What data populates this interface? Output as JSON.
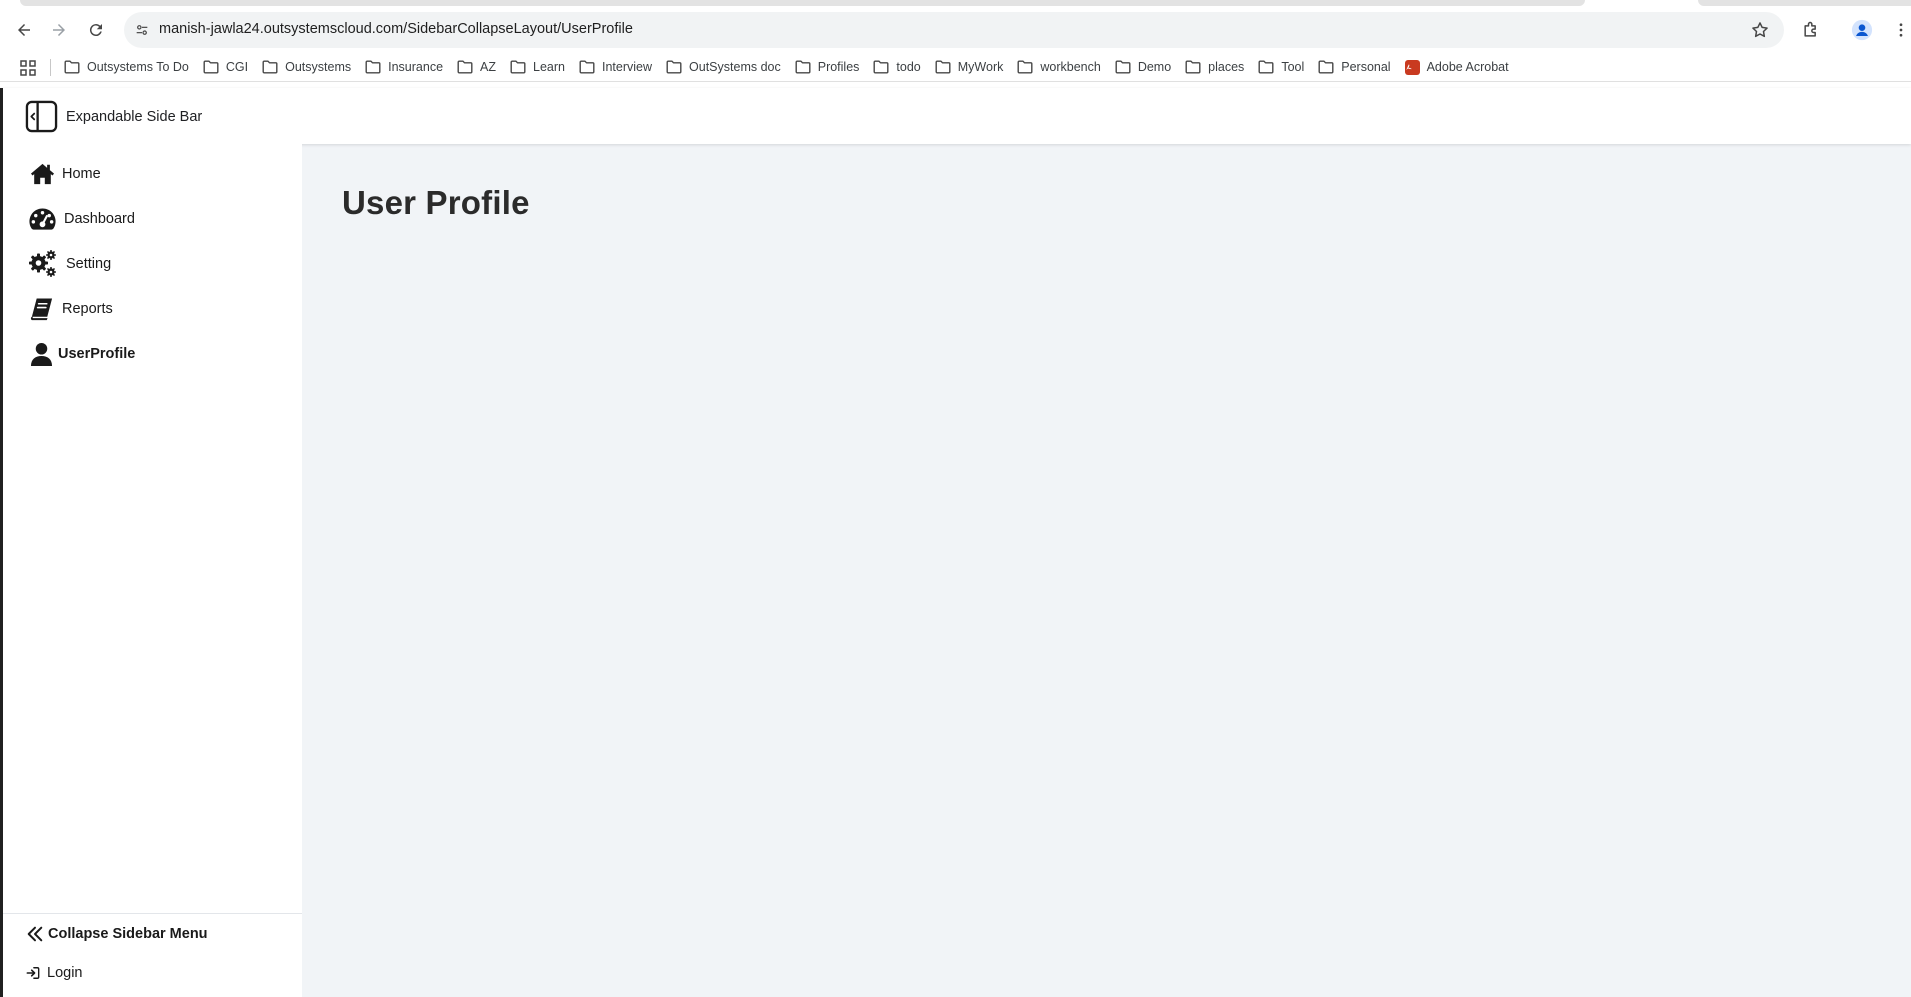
{
  "browser": {
    "url": "manish-jawla24.outsystemscloud.com/SidebarCollapseLayout/UserProfile",
    "bookmarks": [
      {
        "label": "Outsystems To Do",
        "icon": "folder-icon"
      },
      {
        "label": "CGI",
        "icon": "folder-icon"
      },
      {
        "label": "Outsystems",
        "icon": "folder-icon"
      },
      {
        "label": "Insurance",
        "icon": "folder-icon"
      },
      {
        "label": "AZ",
        "icon": "folder-icon"
      },
      {
        "label": "Learn",
        "icon": "folder-icon"
      },
      {
        "label": "Interview",
        "icon": "folder-icon"
      },
      {
        "label": "OutSystems doc",
        "icon": "folder-icon"
      },
      {
        "label": "Profiles",
        "icon": "folder-icon"
      },
      {
        "label": "todo",
        "icon": "folder-icon"
      },
      {
        "label": "MyWork",
        "icon": "folder-icon"
      },
      {
        "label": "workbench",
        "icon": "folder-icon"
      },
      {
        "label": "Demo",
        "icon": "folder-icon"
      },
      {
        "label": "places",
        "icon": "folder-icon"
      },
      {
        "label": "Tool",
        "icon": "folder-icon"
      },
      {
        "label": "Personal",
        "icon": "folder-icon"
      },
      {
        "label": "Adobe Acrobat",
        "icon": "adobe-acrobat-icon"
      }
    ]
  },
  "app": {
    "brand_title": "Expandable Side Bar",
    "menu": [
      {
        "label": "Home",
        "icon": "home-icon",
        "active": false
      },
      {
        "label": "Dashboard",
        "icon": "dashboard-icon",
        "active": false
      },
      {
        "label": "Setting",
        "icon": "gears-icon",
        "active": false
      },
      {
        "label": "Reports",
        "icon": "book-icon",
        "active": false
      },
      {
        "label": "UserProfile",
        "icon": "user-icon",
        "active": true
      }
    ],
    "collapse_label": "Collapse Sidebar Menu",
    "login_label": "Login",
    "page_title": "User Profile"
  },
  "colors": {
    "content_background": "#f1f4f7",
    "sidebar_background": "#ffffff",
    "text_primary": "#1a1a1a",
    "active_indicator": "#1a1a1a"
  }
}
